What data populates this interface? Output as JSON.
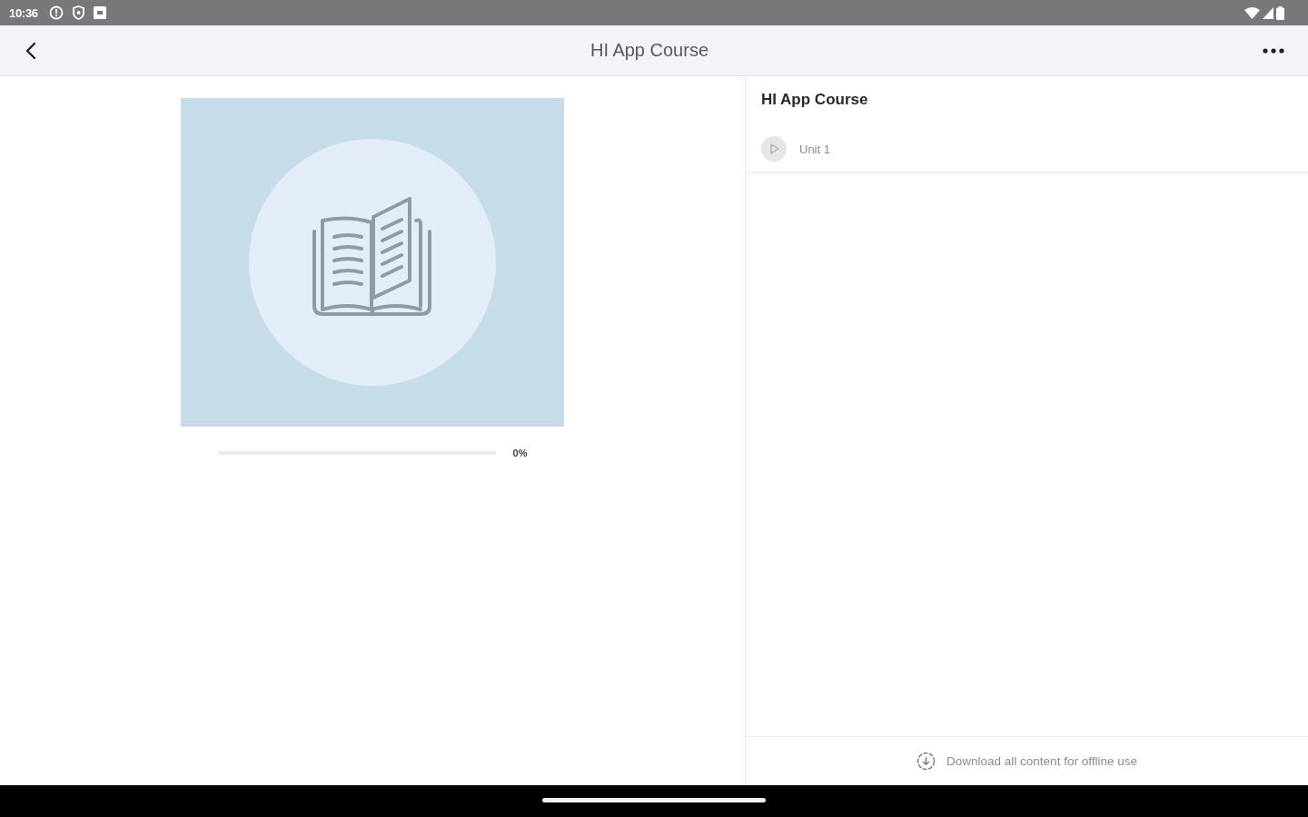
{
  "status_bar": {
    "time": "10:36"
  },
  "app_bar": {
    "title": "HI App Course"
  },
  "course": {
    "progress": {
      "level": 0,
      "reading": "0%"
    }
  },
  "outline": {
    "title": "HI App Course",
    "units": [
      {
        "label": "Unit 1"
      }
    ]
  },
  "footer": {
    "download_label": "Download all content for offline use"
  }
}
